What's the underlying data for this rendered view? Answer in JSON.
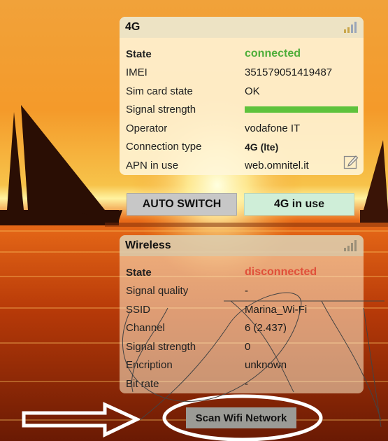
{
  "colors": {
    "accent_green": "#4fae3a",
    "status_red": "#e0503a",
    "signal_bar": "#5ec23c"
  },
  "panel_4g": {
    "title": "4G",
    "icon": "signal-bars-icon",
    "rows": [
      {
        "label": "State",
        "value": "connected"
      },
      {
        "label": "IMEI",
        "value": "351579051419487"
      },
      {
        "label": "Sim card state",
        "value": "OK"
      },
      {
        "label": "Signal strength",
        "value": ""
      },
      {
        "label": "Operator",
        "value": "vodafone IT"
      },
      {
        "label": "Connection type",
        "value": "4G (lte)"
      },
      {
        "label": "APN in use",
        "value": "web.omnitel.it"
      }
    ],
    "edit_icon": "edit-icon"
  },
  "buttons": {
    "auto_switch": "AUTO SWITCH",
    "in_use": "4G in use"
  },
  "panel_wireless": {
    "title": "Wireless",
    "icon": "signal-bars-icon",
    "rows": [
      {
        "label": "State",
        "value": "disconnected"
      },
      {
        "label": "Signal quality",
        "value": "-"
      },
      {
        "label": "SSID",
        "value": "Marina_Wi-Fi"
      },
      {
        "label": "Channel",
        "value": "6 (2.437)"
      },
      {
        "label": "Signal strength",
        "value": "0"
      },
      {
        "label": "Encription",
        "value": "unknown"
      },
      {
        "label": "Bit rate",
        "value": "-"
      }
    ]
  },
  "scan_button": "Scan Wifi Network"
}
